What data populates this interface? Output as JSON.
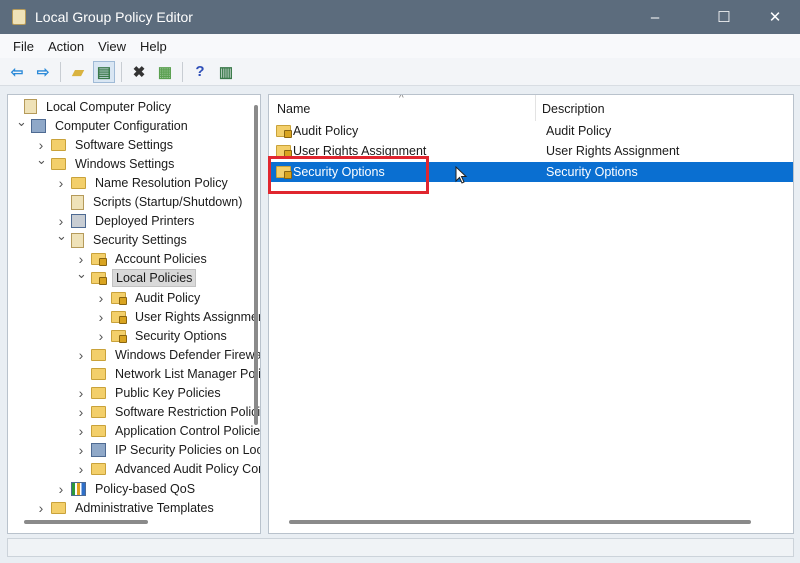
{
  "window": {
    "title": "Local Group Policy Editor",
    "minimize": "–",
    "maximize": "☐",
    "close": "✕"
  },
  "menu": [
    "File",
    "Action",
    "View",
    "Help"
  ],
  "toolbar": [
    {
      "icon": "back-arrow-icon",
      "glyph": "⇦",
      "color": "#2b8ad8"
    },
    {
      "icon": "forward-arrow-icon",
      "glyph": "⇨",
      "color": "#2b8ad8"
    },
    {
      "icon": "up-folder-icon",
      "glyph": "▰",
      "color": "#d9b340"
    },
    {
      "icon": "show-hide-tree-icon",
      "glyph": "▤",
      "color": "#3a7a4a"
    },
    {
      "icon": "delete-icon",
      "glyph": "✖",
      "color": "#333333"
    },
    {
      "icon": "export-list-icon",
      "glyph": "▦",
      "color": "#5aa050"
    },
    {
      "icon": "help-icon",
      "glyph": "?",
      "color": "#2f4fb8"
    },
    {
      "icon": "action-pane-icon",
      "glyph": "▥",
      "color": "#3a7a4a"
    }
  ],
  "tree": [
    {
      "label": "Local Computer Policy",
      "level": 0,
      "chevron": "",
      "icon": "scroll"
    },
    {
      "label": "Computer Configuration",
      "level": 1,
      "chevron": "expanded",
      "icon": "computer"
    },
    {
      "label": "Software Settings",
      "level": 2,
      "chevron": "collapsed",
      "icon": "folder"
    },
    {
      "label": "Windows Settings",
      "level": 2,
      "chevron": "expanded",
      "icon": "folder"
    },
    {
      "label": "Name Resolution Policy",
      "level": 3,
      "chevron": "collapsed",
      "icon": "folder"
    },
    {
      "label": "Scripts (Startup/Shutdown)",
      "level": 3,
      "chevron": "",
      "icon": "scroll"
    },
    {
      "label": "Deployed Printers",
      "level": 3,
      "chevron": "collapsed",
      "icon": "printer"
    },
    {
      "label": "Security Settings",
      "level": 3,
      "chevron": "expanded",
      "icon": "security"
    },
    {
      "label": "Account Policies",
      "level": 4,
      "chevron": "collapsed",
      "icon": "lockfolder"
    },
    {
      "label": "Local Policies",
      "level": 4,
      "chevron": "expanded",
      "icon": "lockfolder",
      "selected": true
    },
    {
      "label": "Audit Policy",
      "level": 5,
      "chevron": "collapsed",
      "icon": "lockfolder"
    },
    {
      "label": "User Rights Assignment",
      "level": 5,
      "chevron": "collapsed",
      "icon": "lockfolder"
    },
    {
      "label": "Security Options",
      "level": 5,
      "chevron": "collapsed",
      "icon": "lockfolder"
    },
    {
      "label": "Windows Defender Firewall",
      "level": 4,
      "chevron": "collapsed",
      "icon": "folder"
    },
    {
      "label": "Network List Manager Policies",
      "level": 4,
      "chevron": "",
      "icon": "folder"
    },
    {
      "label": "Public Key Policies",
      "level": 4,
      "chevron": "collapsed",
      "icon": "folder"
    },
    {
      "label": "Software Restriction Policies",
      "level": 4,
      "chevron": "collapsed",
      "icon": "folder"
    },
    {
      "label": "Application Control Policies",
      "level": 4,
      "chevron": "collapsed",
      "icon": "folder"
    },
    {
      "label": "IP Security Policies on Local Computer",
      "level": 4,
      "chevron": "collapsed",
      "icon": "ipsec"
    },
    {
      "label": "Advanced Audit Policy Configuration",
      "level": 4,
      "chevron": "collapsed",
      "icon": "folder"
    },
    {
      "label": "Policy-based QoS",
      "level": 3,
      "chevron": "collapsed",
      "icon": "chart"
    },
    {
      "label": "Administrative Templates",
      "level": 2,
      "chevron": "collapsed",
      "icon": "folder"
    }
  ],
  "list": {
    "columns": [
      "Name",
      "Description"
    ],
    "sort_indicator": "^",
    "rows": [
      {
        "name": "Audit Policy",
        "description": "Audit Policy"
      },
      {
        "name": "User Rights Assignment",
        "description": "User Rights Assignment"
      },
      {
        "name": "Security Options",
        "description": "Security Options",
        "selected": true
      }
    ]
  },
  "colors": {
    "selection": "#0a6fd1",
    "highlight_box": "#e0262f",
    "titlebar": "#5c6c7d"
  }
}
